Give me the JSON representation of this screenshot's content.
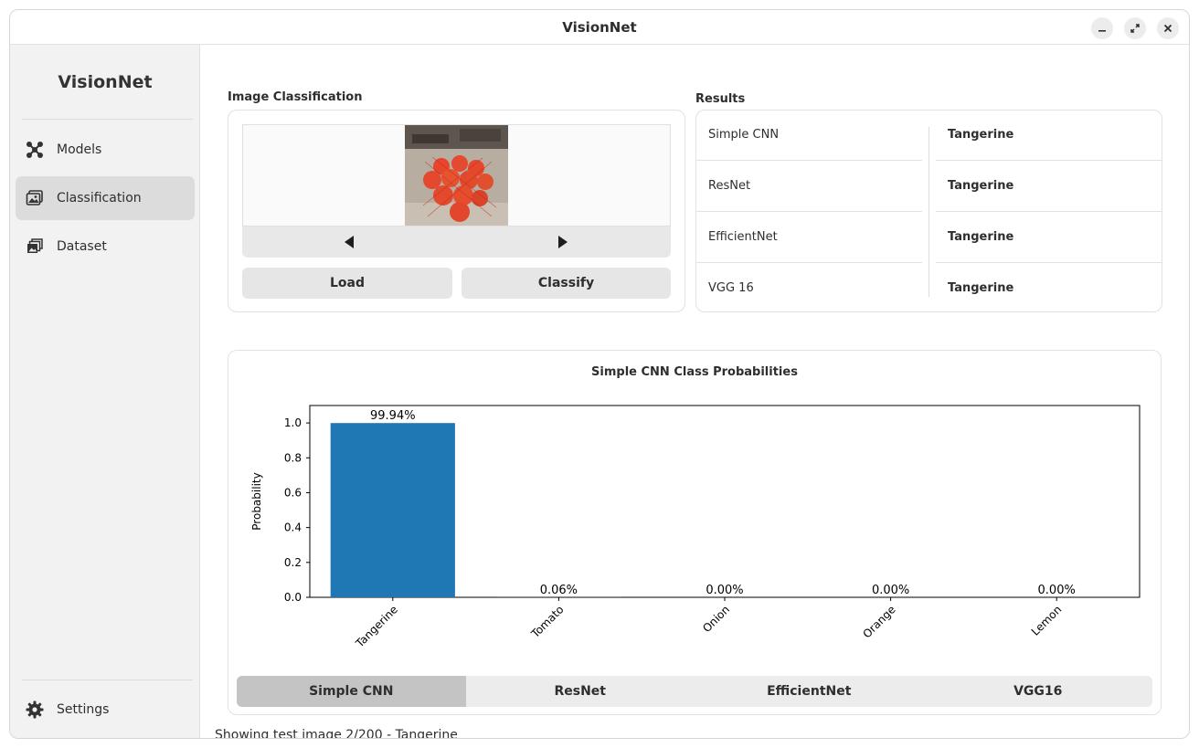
{
  "window": {
    "title": "VisionNet"
  },
  "sidebar": {
    "app_name": "VisionNet",
    "items": [
      {
        "label": "Models",
        "icon": "models-icon"
      },
      {
        "label": "Classification",
        "icon": "image-icon"
      },
      {
        "label": "Dataset",
        "icon": "dataset-icon"
      }
    ],
    "settings_label": "Settings"
  },
  "classification": {
    "section_title": "Image Classification",
    "load_label": "Load",
    "classify_label": "Classify"
  },
  "results": {
    "section_title": "Results",
    "rows": [
      {
        "model": "Simple CNN",
        "prediction": "Tangerine"
      },
      {
        "model": "ResNet",
        "prediction": "Tangerine"
      },
      {
        "model": "EfficientNet",
        "prediction": "Tangerine"
      },
      {
        "model": "VGG 16",
        "prediction": "Tangerine"
      }
    ]
  },
  "chart_data": {
    "type": "bar",
    "title": "Simple CNN Class Probabilities",
    "xlabel": "",
    "ylabel": "Probability",
    "categories": [
      "Tangerine",
      "Tomato",
      "Onion",
      "Orange",
      "Lemon"
    ],
    "values": [
      0.9994,
      0.0006,
      0.0,
      0.0,
      0.0
    ],
    "labels": [
      "99.94%",
      "0.06%",
      "0.00%",
      "0.00%",
      "0.00%"
    ],
    "ylim": [
      0,
      1.1
    ],
    "yticks": [
      "0.0",
      "0.2",
      "0.4",
      "0.6",
      "0.8",
      "1.0"
    ],
    "bar_color": "#1f77b4",
    "grid": false,
    "legend": "none"
  },
  "model_tabs": {
    "tabs": [
      "Simple CNN",
      "ResNet",
      "EfficientNet",
      "VGG16"
    ],
    "active": "Simple CNN"
  },
  "status": {
    "text": "Showing test image 2/200 - Tangerine"
  }
}
